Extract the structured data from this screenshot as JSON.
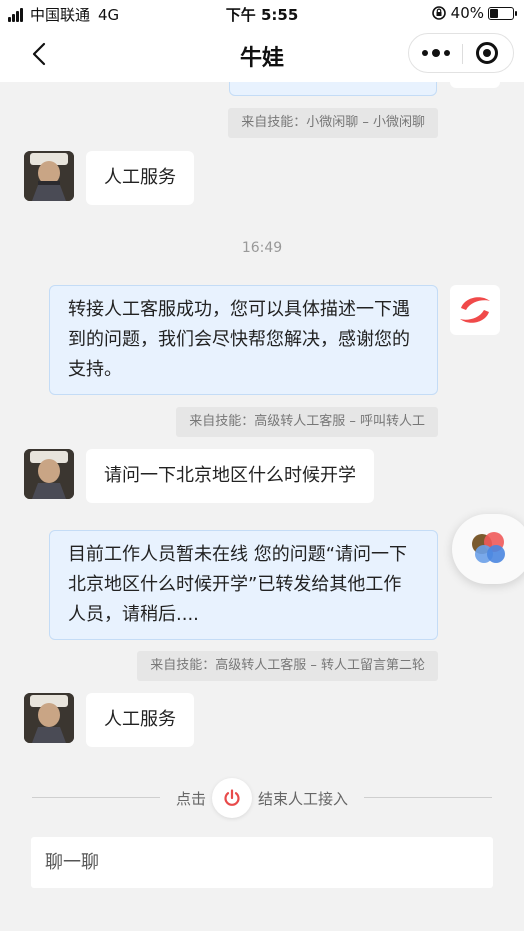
{
  "status_bar": {
    "carrier": "中国联通",
    "network": "4G",
    "time": "下午 5:55",
    "battery": "40%",
    "battery_level": 0.4
  },
  "nav": {
    "title": "牛娃"
  },
  "messages": {
    "user_1": "人工服务",
    "time_1": "16:49",
    "bot_1": "转接人工客服成功，您可以具体描述一下遇到的问题，我们会尽快帮您解决，感谢您的支持。",
    "skill_1": "来自技能：高级转人工客服 – 呼叫转人工",
    "user_2": "请问一下北京地区什么时候开学",
    "bot_2": "目前工作人员暂未在线 您的问题“请问一下北京地区什么时候开学”已转发给其他工作人员，请稍后....",
    "skill_2": "来自技能：高级转人工客服 – 转人工留言第二轮",
    "user_3": "人工服务",
    "skill_0": "来自技能：小微闲聊 – 小微闲聊"
  },
  "footer": {
    "end_prefix": "点击",
    "end_suffix": "结束人工接入",
    "input_placeholder": "聊一聊"
  },
  "colors": {
    "bot_bubble": "#e8f2fe",
    "power_red": "#e84a4a",
    "logo_red": "#f04a4a"
  }
}
